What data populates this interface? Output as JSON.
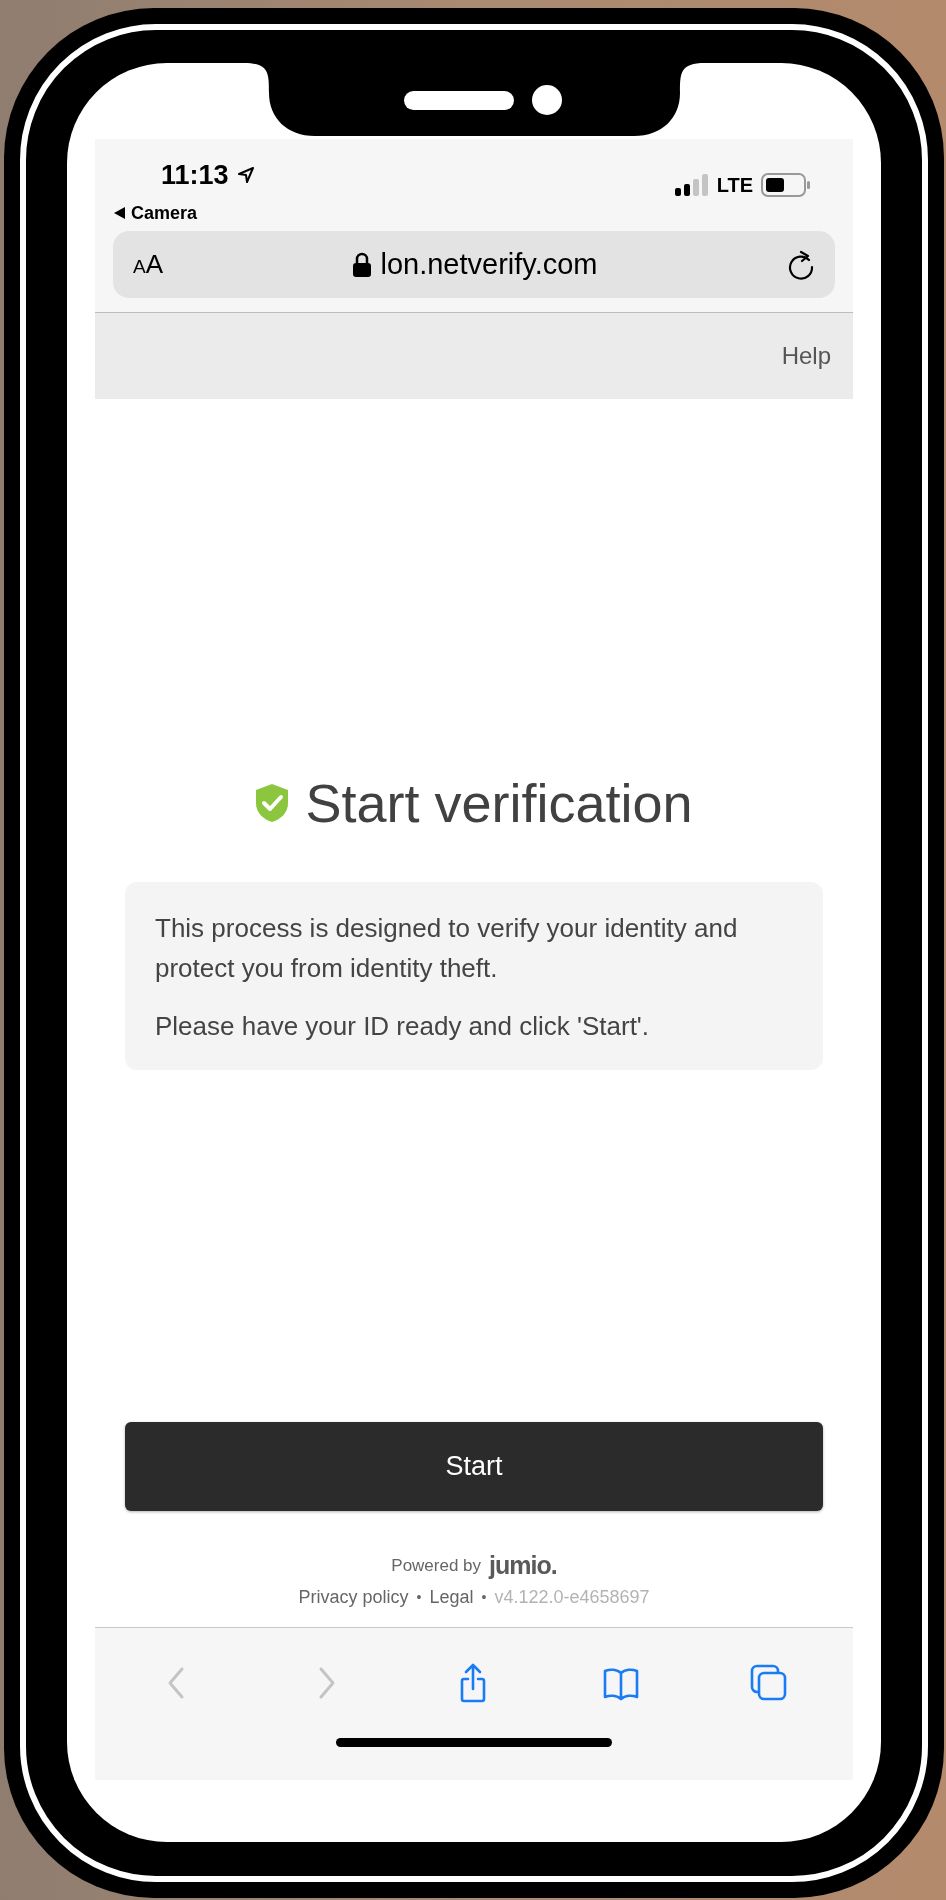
{
  "status_bar": {
    "time": "11:13",
    "back_label": "Camera",
    "network": "LTE"
  },
  "address_bar": {
    "text_size_label": "AA",
    "url": "lon.netverify.com"
  },
  "header": {
    "help_link": "Help"
  },
  "title": "Start verification",
  "info_paragraphs": [
    "This process is designed to verify your identity and protect you from identity theft.",
    "Please have your ID ready and click 'Start'."
  ],
  "start_button": "Start",
  "footer": {
    "powered_by": "Powered by",
    "brand": "jumio.",
    "items": [
      {
        "kind": "link",
        "text": "Privacy policy"
      },
      {
        "kind": "separator",
        "text": "•"
      },
      {
        "kind": "link",
        "text": "Legal"
      },
      {
        "kind": "separator",
        "text": "•"
      },
      {
        "kind": "version",
        "text": "v4.122.0-e4658697"
      }
    ]
  },
  "toolbar": [
    {
      "kind": "back",
      "disabled": true
    },
    {
      "kind": "forward",
      "disabled": true
    },
    {
      "kind": "share",
      "disabled": false
    },
    {
      "kind": "bookmarks",
      "disabled": false
    },
    {
      "kind": "tabs",
      "disabled": false
    }
  ]
}
